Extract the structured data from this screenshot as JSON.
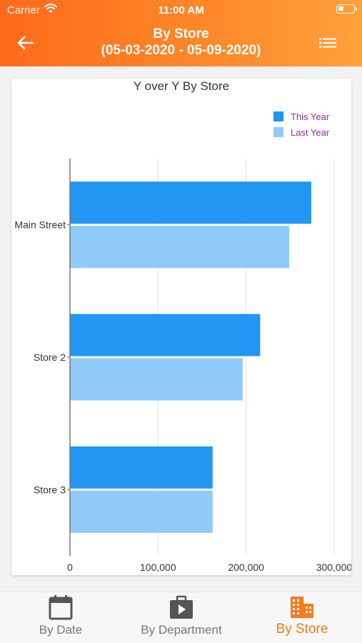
{
  "status_bar": {
    "carrier": "Carrier",
    "time": "11:00 AM"
  },
  "header": {
    "title": "By Store",
    "date_range": "(05-03-2020 - 05-09-2020)"
  },
  "chart_data": {
    "type": "bar",
    "orientation": "horizontal",
    "title": "Y over Y By Store",
    "categories": [
      "Main Street",
      "Store 2",
      "Store 3"
    ],
    "series": [
      {
        "name": "This Year",
        "values": [
          274000,
          216000,
          162000
        ],
        "color": "#2196f3"
      },
      {
        "name": "Last Year",
        "values": [
          249000,
          196000,
          162000
        ],
        "color": "#90caf9"
      }
    ],
    "xlim": [
      0,
      300000
    ],
    "x_ticks": [
      "0",
      "100,000",
      "200,000",
      "300,000"
    ],
    "grid": true,
    "legend_position": "top-right",
    "legend_text_color": "#9c27b0"
  },
  "tabs": [
    {
      "label": "By Date",
      "icon": "calendar-icon",
      "active": false
    },
    {
      "label": "By Department",
      "icon": "briefcase-icon",
      "active": false
    },
    {
      "label": "By Store",
      "icon": "building-icon",
      "active": true
    }
  ],
  "colors": {
    "accent": "#f57c1f",
    "inactive": "#555555"
  }
}
